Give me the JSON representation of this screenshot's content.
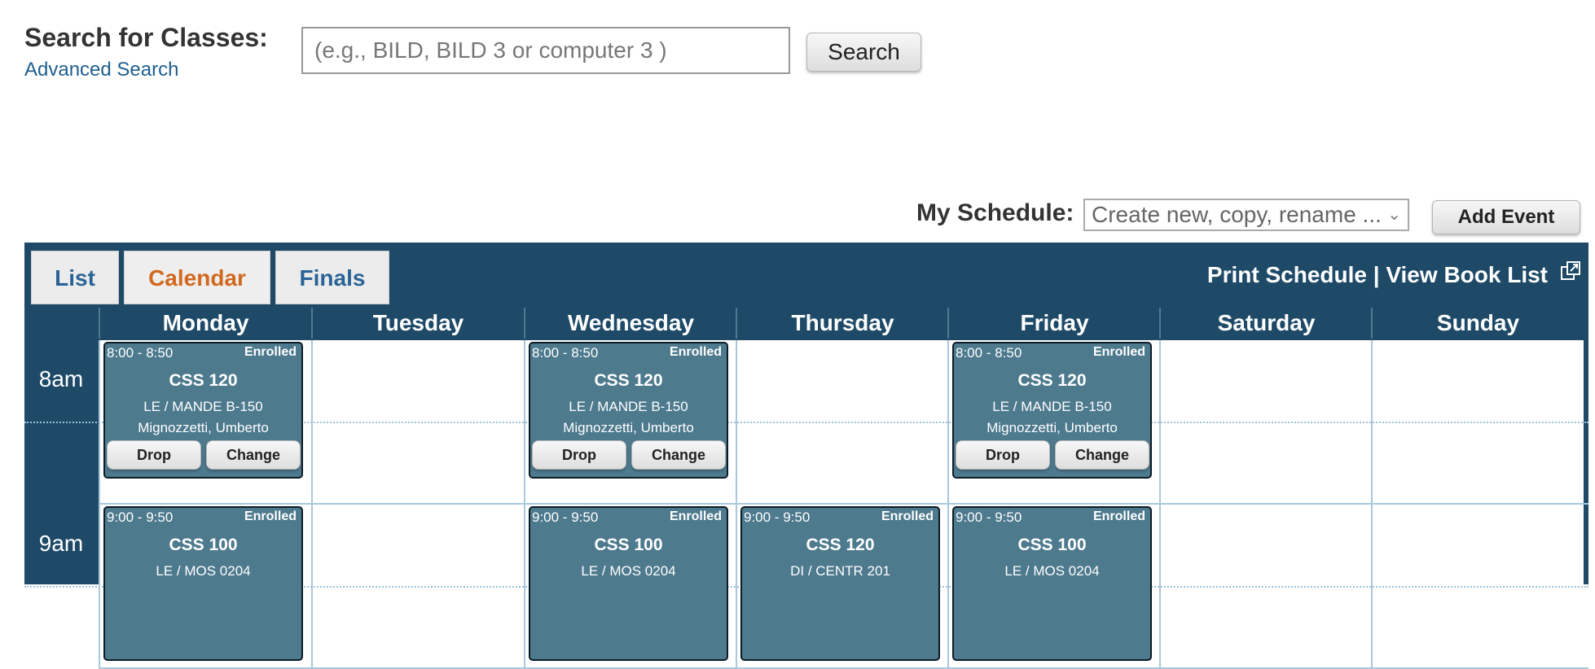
{
  "search": {
    "heading": "Search for Classes:",
    "advanced_link": "Advanced Search",
    "placeholder": "(e.g., BILD, BILD 3 or computer 3 )",
    "button": "Search"
  },
  "schedule": {
    "label": "My Schedule:",
    "select_value": "Create new, copy, rename ...",
    "add_event": "Add Event"
  },
  "tabs": [
    "List",
    "Calendar",
    "Finals"
  ],
  "active_tab": "Calendar",
  "links": {
    "print": "Print Schedule",
    "separator": "|",
    "book_list": "View Book List"
  },
  "days": [
    "Monday",
    "Tuesday",
    "Wednesday",
    "Thursday",
    "Friday",
    "Saturday",
    "Sunday"
  ],
  "hours": [
    "8am",
    "9am"
  ],
  "events": [
    {
      "day": "Monday",
      "hour": "8am",
      "time": "8:00 - 8:50",
      "status": "Enrolled",
      "course": "CSS 120",
      "location": "LE / MANDE B-150",
      "instructor": "Mignozzetti, Umberto",
      "drop": "Drop",
      "change": "Change"
    },
    {
      "day": "Wednesday",
      "hour": "8am",
      "time": "8:00 - 8:50",
      "status": "Enrolled",
      "course": "CSS 120",
      "location": "LE / MANDE B-150",
      "instructor": "Mignozzetti, Umberto",
      "drop": "Drop",
      "change": "Change"
    },
    {
      "day": "Friday",
      "hour": "8am",
      "time": "8:00 - 8:50",
      "status": "Enrolled",
      "course": "CSS 120",
      "location": "LE / MANDE B-150",
      "instructor": "Mignozzetti, Umberto",
      "drop": "Drop",
      "change": "Change"
    },
    {
      "day": "Monday",
      "hour": "9am",
      "time": "9:00 - 9:50",
      "status": "Enrolled",
      "course": "CSS 100",
      "location": "LE / MOS 0204"
    },
    {
      "day": "Wednesday",
      "hour": "9am",
      "time": "9:00 - 9:50",
      "status": "Enrolled",
      "course": "CSS 100",
      "location": "LE / MOS 0204"
    },
    {
      "day": "Thursday",
      "hour": "9am",
      "time": "9:00 - 9:50",
      "status": "Enrolled",
      "course": "CSS 120",
      "location": "DI / CENTR 201"
    },
    {
      "day": "Friday",
      "hour": "9am",
      "time": "9:00 - 9:50",
      "status": "Enrolled",
      "course": "CSS 100",
      "location": "LE / MOS 0204"
    }
  ]
}
